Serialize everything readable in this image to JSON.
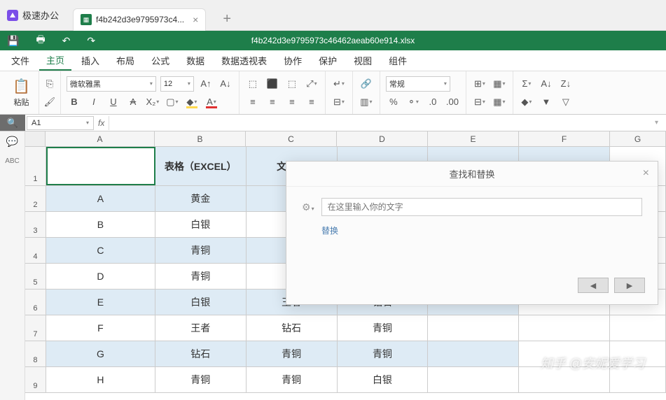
{
  "app": {
    "name": "极速办公"
  },
  "tab": {
    "name": "f4b242d3e9795973c4...",
    "close": "×",
    "plus": "+"
  },
  "file": {
    "title": "f4b242d3e9795973c46462aeab60e914.xlsx"
  },
  "menu": {
    "items": [
      "文件",
      "主页",
      "插入",
      "布局",
      "公式",
      "数据",
      "数据透视表",
      "协作",
      "保护",
      "视图",
      "组件"
    ],
    "activeIndex": 1
  },
  "ribbon": {
    "paste": "粘贴",
    "font": "微软雅黑",
    "size": "12",
    "style": "常规"
  },
  "namebox": {
    "cell": "A1"
  },
  "columns": [
    "A",
    "B",
    "C",
    "D",
    "E",
    "F",
    "G"
  ],
  "rows": {
    "header": [
      "",
      "表格（EXCEL）",
      "文字（",
      "",
      "",
      ""
    ],
    "data": [
      {
        "n": "2",
        "alt": false,
        "v": [
          "A",
          "黄金",
          "",
          "",
          ""
        ]
      },
      {
        "n": "3",
        "alt": true,
        "v": [
          "B",
          "白银",
          "",
          "",
          ""
        ]
      },
      {
        "n": "4",
        "alt": false,
        "v": [
          "C",
          "青铜",
          "",
          "",
          ""
        ]
      },
      {
        "n": "5",
        "alt": true,
        "v": [
          "D",
          "青铜",
          "",
          "",
          ""
        ]
      },
      {
        "n": "6",
        "alt": false,
        "v": [
          "E",
          "白银",
          "王者",
          "钻石",
          ""
        ]
      },
      {
        "n": "7",
        "alt": true,
        "v": [
          "F",
          "王者",
          "钻石",
          "青铜",
          ""
        ]
      },
      {
        "n": "8",
        "alt": false,
        "v": [
          "G",
          "钻石",
          "青铜",
          "青铜",
          ""
        ]
      },
      {
        "n": "9",
        "alt": true,
        "v": [
          "H",
          "青铜",
          "青铜",
          "白银",
          ""
        ]
      }
    ]
  },
  "dialog": {
    "title": "查找和替换",
    "placeholder": "在这里输入你的文字",
    "replace": "替换",
    "prev": "◀",
    "next": "▶",
    "close": "×"
  },
  "watermark": "知乎 @安妮爱学习"
}
